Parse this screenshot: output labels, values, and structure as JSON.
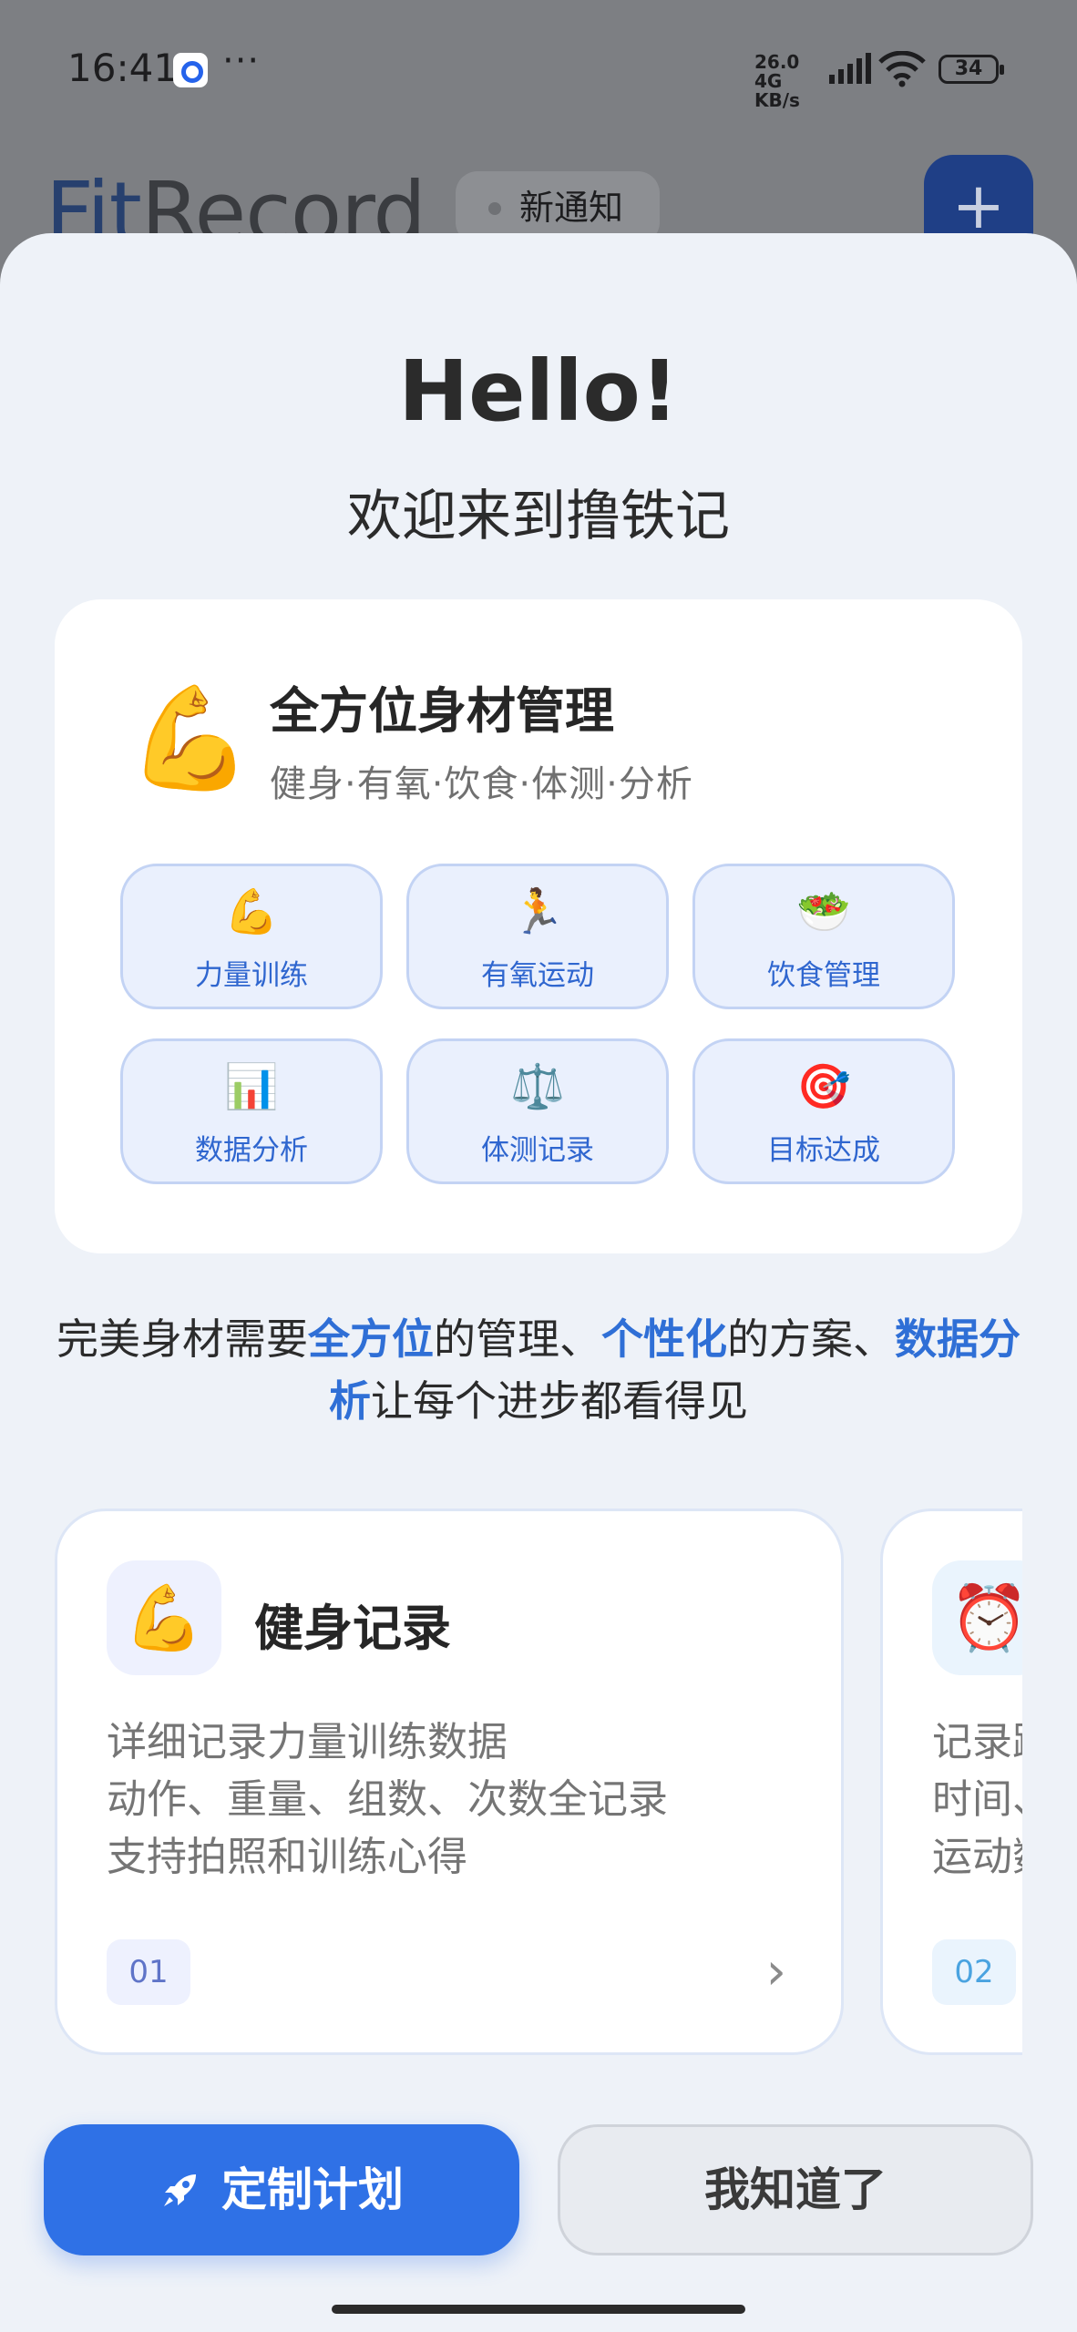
{
  "status_bar": {
    "time": "16:41",
    "more": "···",
    "net_speed": "26.0 4G KB/s",
    "battery": "34"
  },
  "background_app": {
    "logo_fit": "Fit",
    "logo_rest": "Record",
    "notice_label": "新通知",
    "add_button": "+"
  },
  "sheet": {
    "hello": "Hello!",
    "welcome": "欢迎来到撸铁记",
    "top_card": {
      "emoji": "💪",
      "title": "全方位身材管理",
      "subtitle": "健身·有氧·饮食·体测·分析",
      "features": [
        {
          "icon": "💪",
          "label": "力量训练"
        },
        {
          "icon": "🏃",
          "label": "有氧运动"
        },
        {
          "icon": "🥗",
          "label": "饮食管理"
        },
        {
          "icon": "📊",
          "label": "数据分析"
        },
        {
          "icon": "⚖️",
          "label": "体测记录"
        },
        {
          "icon": "🎯",
          "label": "目标达成"
        }
      ]
    },
    "description": {
      "p1": "完美身材需要",
      "h1": "全方位",
      "p2": "的管理、",
      "h2": "个性化",
      "p3": "的方案、",
      "h3": "数据分析",
      "p4": "让每个进步都看得见"
    },
    "cards": [
      {
        "icon": "💪",
        "title": "健身记录",
        "lines": [
          "详细记录力量训练数据",
          "动作、重量、组数、次数全记录",
          "支持拍照和训练心得"
        ],
        "number": "01",
        "arrow": "›"
      },
      {
        "icon": "⏰",
        "title": "",
        "lines": [
          "记录跑",
          "时间、",
          "运动数"
        ],
        "number": "02"
      }
    ],
    "buttons": {
      "primary": "定制计划",
      "secondary": "我知道了"
    }
  },
  "colors": {
    "accent": "#2f71e6",
    "highlight_text": "#2f6fd6",
    "feature_bg": "#eaf0fd",
    "sheet_bg": "#eef2f8",
    "overlay": "#7d7f83"
  }
}
